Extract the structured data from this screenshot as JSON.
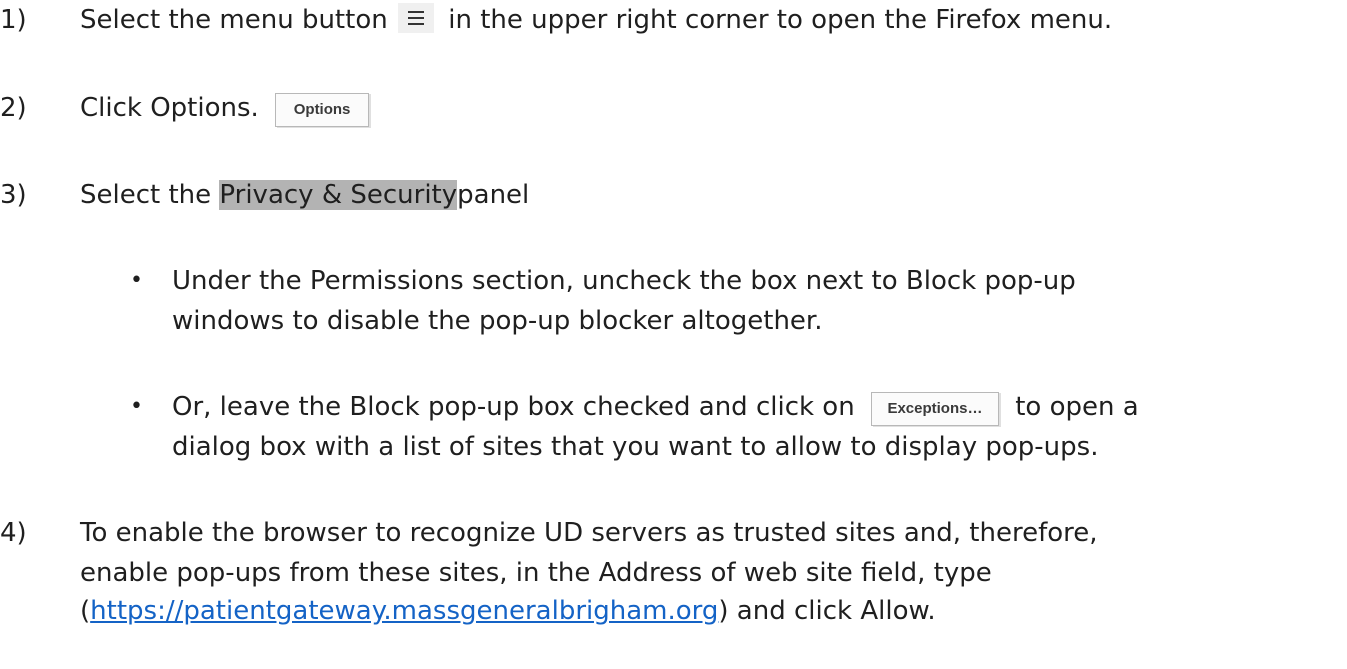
{
  "steps": [
    {
      "number": "1)",
      "before": "Select the menu button",
      "icon": "hamburger-menu-icon",
      "after": "in the upper right corner to open the Firefox menu."
    },
    {
      "number": "2)",
      "text": "Click Options.",
      "button": "Options"
    },
    {
      "number": "3)",
      "before": "Select the",
      "highlight": "Privacy & Security",
      "after": "panel"
    },
    {
      "number": "4)",
      "line1": "To enable the browser to recognize UD servers as trusted sites and, therefore,",
      "line2": "enable pop-ups from these sites, in the Address of web site field, type",
      "paren_open": "(",
      "link": "https://patientgateway.massgeneralbrigham.org",
      "after_link": ") and click Allow."
    }
  ],
  "bullets": [
    {
      "marker": "•",
      "line1": "Under the Permissions section, uncheck the box next to Block pop-up",
      "line2": "windows to disable the pop-up blocker altogether."
    },
    {
      "marker": "•",
      "before": "Or, leave the Block pop-up box checked and click on",
      "button": "Exceptions…",
      "after": "to open a",
      "line2": "dialog box with a list of sites that you want to allow to display pop-ups."
    }
  ]
}
